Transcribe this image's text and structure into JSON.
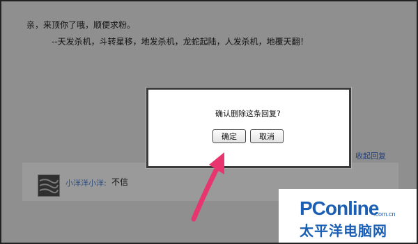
{
  "post": {
    "line1": "亲，来顶你了哦，顺便求粉。",
    "line2": "--天发杀机，斗转星移，地发杀机，龙蛇起陆，人发杀机，地覆天翻！"
  },
  "reply": {
    "collapse_label": "收起回复",
    "username": "小洋洋小洋:",
    "text": "不信"
  },
  "dialog": {
    "message": "确认删除这条回复?",
    "ok_label": "确定",
    "cancel_label": "取消"
  },
  "watermark": {
    "brand": "PConline",
    "domain": ".com.cn",
    "subtitle": "太平洋电脑网"
  },
  "colors": {
    "overlay": "#8f8f8f",
    "arrow": "#e8356f",
    "brand": "#1a5fb3"
  }
}
